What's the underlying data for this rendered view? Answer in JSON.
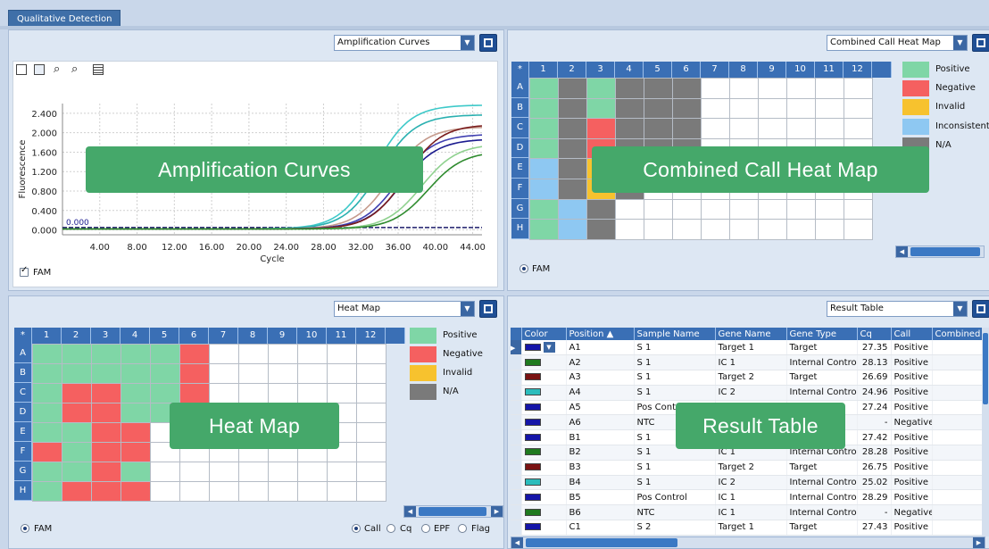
{
  "tab": {
    "title": "Qualitative Detection"
  },
  "amplification": {
    "dropdown": "Amplification Curves",
    "overlay": "Amplification Curves",
    "fam_checkbox": "FAM",
    "baseline_label": "0.000"
  },
  "chart_data": {
    "type": "line",
    "title": "",
    "xlabel": "Cycle",
    "ylabel": "Fluorescence",
    "xlim": [
      0,
      45
    ],
    "ylim": [
      -0.1,
      2.6
    ],
    "x_ticks": [
      "4.00",
      "8.00",
      "12.00",
      "16.00",
      "20.00",
      "24.00",
      "28.00",
      "32.00",
      "36.00",
      "40.00",
      "44.00"
    ],
    "y_ticks": [
      "0.000",
      "0.400",
      "0.800",
      "1.200",
      "1.600",
      "2.000",
      "2.400"
    ],
    "grid": true,
    "series": [
      {
        "color": "#3ec9c9",
        "ct": 29.5,
        "plateau": 2.55
      },
      {
        "color": "#2ab0b0",
        "ct": 30.0,
        "plateau": 2.35
      },
      {
        "color": "#c59a8c",
        "ct": 31.2,
        "plateau": 2.1
      },
      {
        "color": "#3f3fb0",
        "ct": 32.0,
        "plateau": 1.95
      },
      {
        "color": "#1b1b8f",
        "ct": 32.4,
        "plateau": 1.85
      },
      {
        "color": "#7a1c1c",
        "ct": 32.8,
        "plateau": 2.15
      },
      {
        "color": "#8fd18f",
        "ct": 34.5,
        "plateau": 1.75
      },
      {
        "color": "#2e8b2e",
        "ct": 35.2,
        "plateau": 1.6
      }
    ]
  },
  "combined_heatmap": {
    "dropdown": "Combined Call Heat Map",
    "overlay": "Combined Call Heat Map",
    "columns": [
      "*",
      "1",
      "2",
      "3",
      "4",
      "5",
      "6",
      "7",
      "8",
      "9",
      "10",
      "11",
      "12"
    ],
    "rows": [
      "A",
      "B",
      "C",
      "D",
      "E",
      "F",
      "G",
      "H"
    ],
    "cells": [
      [
        "P",
        "X",
        "P",
        "X",
        "X",
        "X",
        "",
        "",
        "",
        "",
        "",
        ""
      ],
      [
        "P",
        "X",
        "P",
        "X",
        "X",
        "X",
        "",
        "",
        "",
        "",
        "",
        ""
      ],
      [
        "P",
        "X",
        "N",
        "X",
        "X",
        "X",
        "",
        "",
        "",
        "",
        "",
        ""
      ],
      [
        "P",
        "X",
        "N",
        "X",
        "X",
        "X",
        "",
        "",
        "",
        "",
        "",
        ""
      ],
      [
        "C",
        "X",
        "I",
        "X",
        "",
        "",
        "",
        "",
        "",
        "",
        "",
        ""
      ],
      [
        "C",
        "X",
        "I",
        "X",
        "",
        "",
        "",
        "",
        "",
        "",
        "",
        ""
      ],
      [
        "P",
        "C",
        "X",
        "",
        "",
        "",
        "",
        "",
        "",
        "",
        "",
        ""
      ],
      [
        "P",
        "C",
        "X",
        "",
        "",
        "",
        "",
        "",
        "",
        "",
        "",
        ""
      ]
    ],
    "legend": [
      {
        "label": "Positive",
        "color": "#7fd6a6"
      },
      {
        "label": "Negative",
        "color": "#f56060"
      },
      {
        "label": "Invalid",
        "color": "#f7c22e"
      },
      {
        "label": "Inconsistent",
        "color": "#8ec8f2"
      },
      {
        "label": "N/A",
        "color": "#7a7a7a"
      }
    ],
    "fam": "FAM"
  },
  "heatmap": {
    "dropdown": "Heat Map",
    "overlay": "Heat Map",
    "columns": [
      "*",
      "1",
      "2",
      "3",
      "4",
      "5",
      "6",
      "7",
      "8",
      "9",
      "10",
      "11",
      "12"
    ],
    "rows": [
      "A",
      "B",
      "C",
      "D",
      "E",
      "F",
      "G",
      "H"
    ],
    "cells": [
      [
        "P",
        "P",
        "P",
        "P",
        "P",
        "N",
        "",
        "",
        "",
        "",
        "",
        ""
      ],
      [
        "P",
        "P",
        "P",
        "P",
        "P",
        "N",
        "",
        "",
        "",
        "",
        "",
        ""
      ],
      [
        "P",
        "N",
        "N",
        "P",
        "P",
        "N",
        "",
        "",
        "",
        "",
        "",
        ""
      ],
      [
        "P",
        "N",
        "N",
        "P",
        "P",
        "P",
        "",
        "",
        "",
        "",
        "",
        ""
      ],
      [
        "P",
        "P",
        "N",
        "N",
        "",
        "",
        "",
        "",
        "",
        "",
        "",
        ""
      ],
      [
        "N",
        "P",
        "N",
        "N",
        "",
        "",
        "",
        "",
        "",
        "",
        "",
        ""
      ],
      [
        "P",
        "P",
        "N",
        "P",
        "",
        "",
        "",
        "",
        "",
        "",
        "",
        ""
      ],
      [
        "P",
        "N",
        "N",
        "N",
        "",
        "",
        "",
        "",
        "",
        "",
        "",
        ""
      ]
    ],
    "legend": [
      {
        "label": "Positive",
        "color": "#7fd6a6"
      },
      {
        "label": "Negative",
        "color": "#f56060"
      },
      {
        "label": "Invalid",
        "color": "#f7c22e"
      },
      {
        "label": "N/A",
        "color": "#7a7a7a"
      }
    ],
    "fam": "FAM",
    "modes": [
      "Call",
      "Cq",
      "EPF",
      "Flag"
    ]
  },
  "result_table": {
    "dropdown": "Result Table",
    "overlay": "Result Table",
    "headers": [
      "Color",
      "Position ▲",
      "Sample Name",
      "Gene Name",
      "Gene Type",
      "Cq",
      "Call",
      "Combined Re"
    ],
    "rows": [
      {
        "color": "#1515a8",
        "pos": "A1",
        "sample": "S 1",
        "gene": "Target 1",
        "type": "Target",
        "cq": "27.35",
        "call": "Positive"
      },
      {
        "color": "#1f7a1f",
        "pos": "A2",
        "sample": "S 1",
        "gene": "IC 1",
        "type": "Internal Control",
        "cq": "28.13",
        "call": "Positive"
      },
      {
        "color": "#7a1212",
        "pos": "A3",
        "sample": "S 1",
        "gene": "Target 2",
        "type": "Target",
        "cq": "26.69",
        "call": "Positive"
      },
      {
        "color": "#2bbcbc",
        "pos": "A4",
        "sample": "S 1",
        "gene": "IC 2",
        "type": "Internal Control",
        "cq": "24.96",
        "call": "Positive"
      },
      {
        "color": "#1515a8",
        "pos": "A5",
        "sample": "Pos Control",
        "gene": "",
        "type": "",
        "cq": "27.24",
        "call": "Positive"
      },
      {
        "color": "#1515a8",
        "pos": "A6",
        "sample": "NTC",
        "gene": "",
        "type": "",
        "cq": "-",
        "call": "Negative"
      },
      {
        "color": "#1515a8",
        "pos": "B1",
        "sample": "S 1",
        "gene": "",
        "type": "",
        "cq": "27.42",
        "call": "Positive"
      },
      {
        "color": "#1f7a1f",
        "pos": "B2",
        "sample": "S 1",
        "gene": "IC 1",
        "type": "Internal Control",
        "cq": "28.28",
        "call": "Positive"
      },
      {
        "color": "#7a1212",
        "pos": "B3",
        "sample": "S 1",
        "gene": "Target 2",
        "type": "Target",
        "cq": "26.75",
        "call": "Positive"
      },
      {
        "color": "#2bbcbc",
        "pos": "B4",
        "sample": "S 1",
        "gene": "IC 2",
        "type": "Internal Control",
        "cq": "25.02",
        "call": "Positive"
      },
      {
        "color": "#1515a8",
        "pos": "B5",
        "sample": "Pos Control",
        "gene": "IC 1",
        "type": "Internal Control",
        "cq": "28.29",
        "call": "Positive"
      },
      {
        "color": "#1f7a1f",
        "pos": "B6",
        "sample": "NTC",
        "gene": "IC 1",
        "type": "Internal Control",
        "cq": "-",
        "call": "Negative"
      },
      {
        "color": "#1515a8",
        "pos": "C1",
        "sample": "S 2",
        "gene": "Target 1",
        "type": "Target",
        "cq": "27.43",
        "call": "Positive"
      }
    ]
  }
}
